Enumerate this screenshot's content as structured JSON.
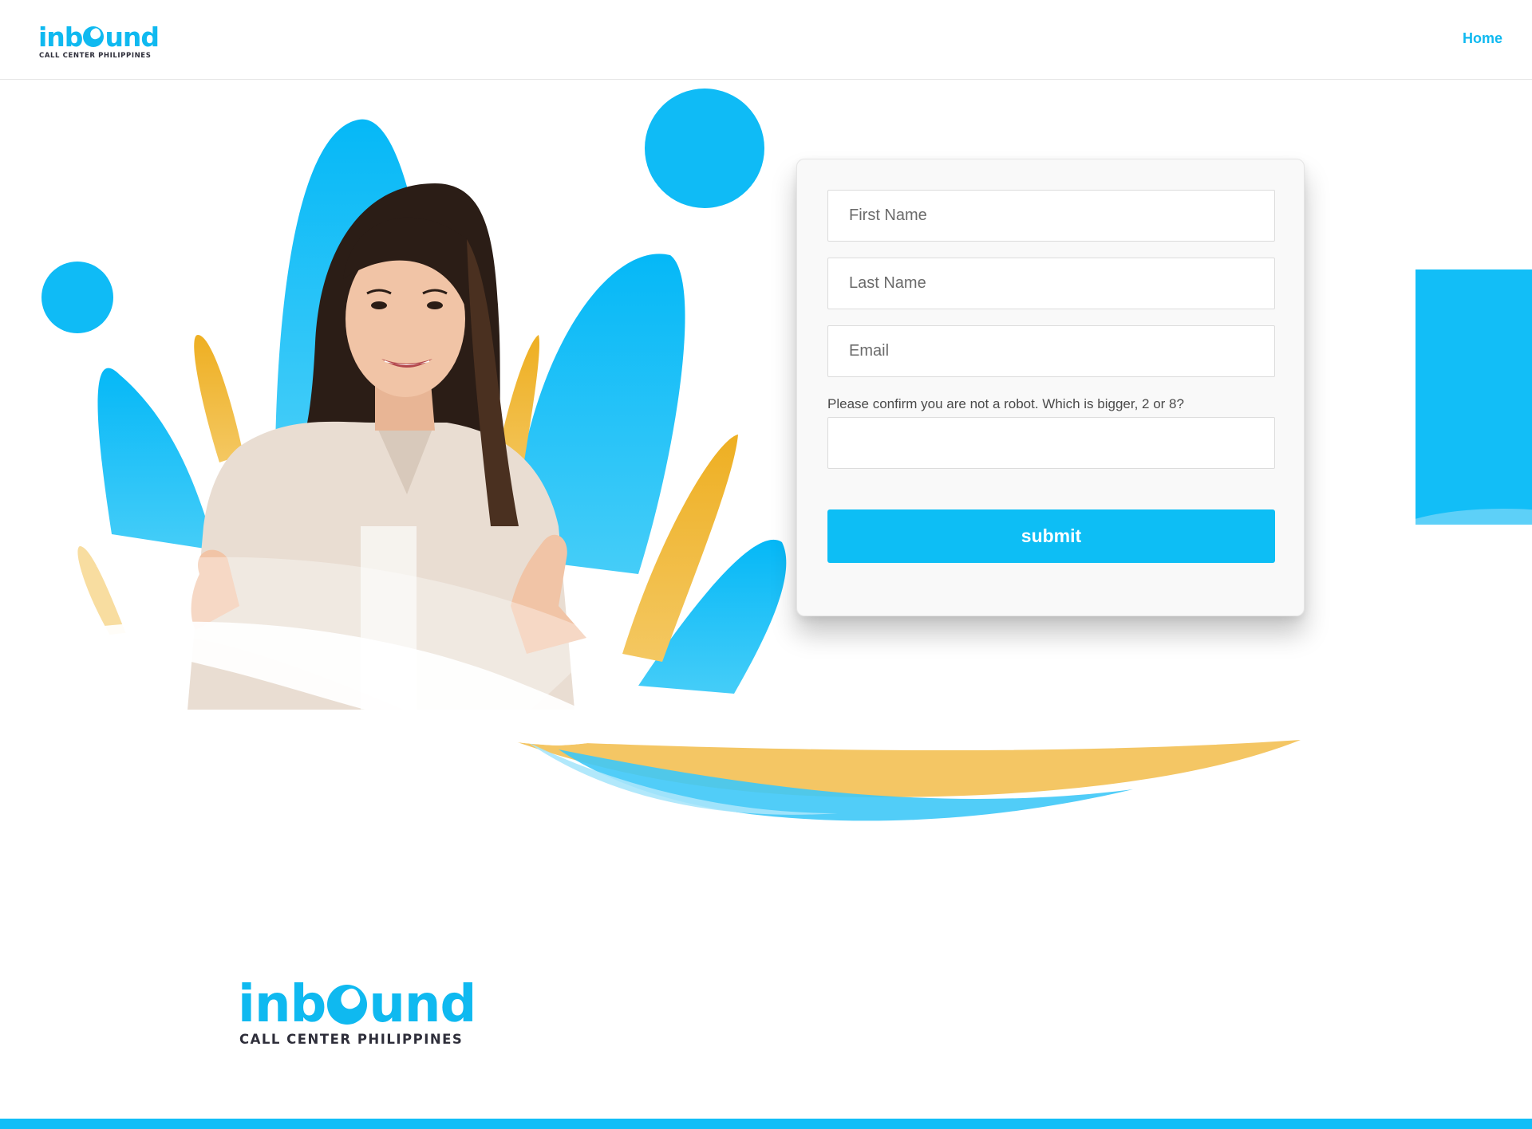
{
  "header": {
    "logo": {
      "word_left": "inb",
      "word_right": "und",
      "tagline": "CALL CENTER PHILIPPINES"
    },
    "nav": {
      "home_label": "Home"
    }
  },
  "form": {
    "first_name_placeholder": "First Name",
    "last_name_placeholder": "Last Name",
    "email_placeholder": "Email",
    "captcha_label": "Please confirm you are not a robot. Which is bigger, 2 or 8?",
    "captcha_value": "",
    "submit_label": "submit"
  },
  "footer": {
    "logo": {
      "word_left": "inb",
      "word_right": "und",
      "tagline": "CALL CENTER PHILIPPINES"
    }
  },
  "colors": {
    "brand_blue": "#0fb9f0",
    "accent_yellow": "#f0b429",
    "logo_dark": "#2e2e3a"
  }
}
